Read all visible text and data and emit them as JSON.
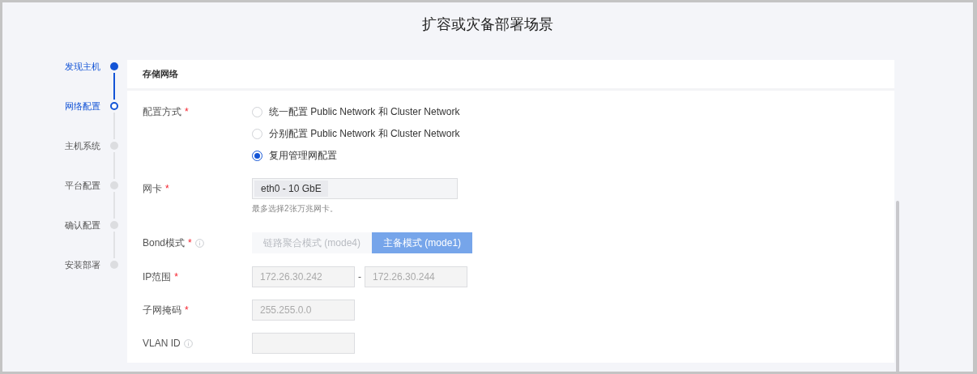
{
  "title": "扩容或灾备部署场景",
  "steps": [
    {
      "label": "发现主机",
      "reached": true,
      "current": false
    },
    {
      "label": "网络配置",
      "reached": true,
      "current": true
    },
    {
      "label": "主机系统",
      "reached": false,
      "current": false
    },
    {
      "label": "平台配置",
      "reached": false,
      "current": false
    },
    {
      "label": "确认配置",
      "reached": false,
      "current": false
    },
    {
      "label": "安装部署",
      "reached": false,
      "current": false
    }
  ],
  "section": {
    "title": "存储网络"
  },
  "config_mode": {
    "label": "配置方式",
    "required_mark": "*",
    "options": [
      {
        "label": "统一配置 Public Network 和 Cluster Network",
        "selected": false
      },
      {
        "label": "分别配置 Public Network 和 Cluster Network",
        "selected": false
      },
      {
        "label": "复用管理网配置",
        "selected": true
      }
    ]
  },
  "nic": {
    "label": "网卡",
    "required_mark": "*",
    "tags": [
      "eth0 - 10 GbE"
    ],
    "hint": "最多选择2张万兆网卡。"
  },
  "bond": {
    "label": "Bond模式",
    "required_mark": "*",
    "info": true,
    "options": [
      {
        "label": "链路聚合模式 (mode4)",
        "selected": false
      },
      {
        "label": "主备模式 (mode1)",
        "selected": true
      }
    ]
  },
  "ip_range": {
    "label": "IP范围",
    "required_mark": "*",
    "from": "172.26.30.242",
    "separator": "-",
    "to": "172.26.30.244"
  },
  "subnet": {
    "label": "子网掩码",
    "required_mark": "*",
    "value": "255.255.0.0"
  },
  "vlan": {
    "label": "VLAN ID",
    "info": true
  }
}
